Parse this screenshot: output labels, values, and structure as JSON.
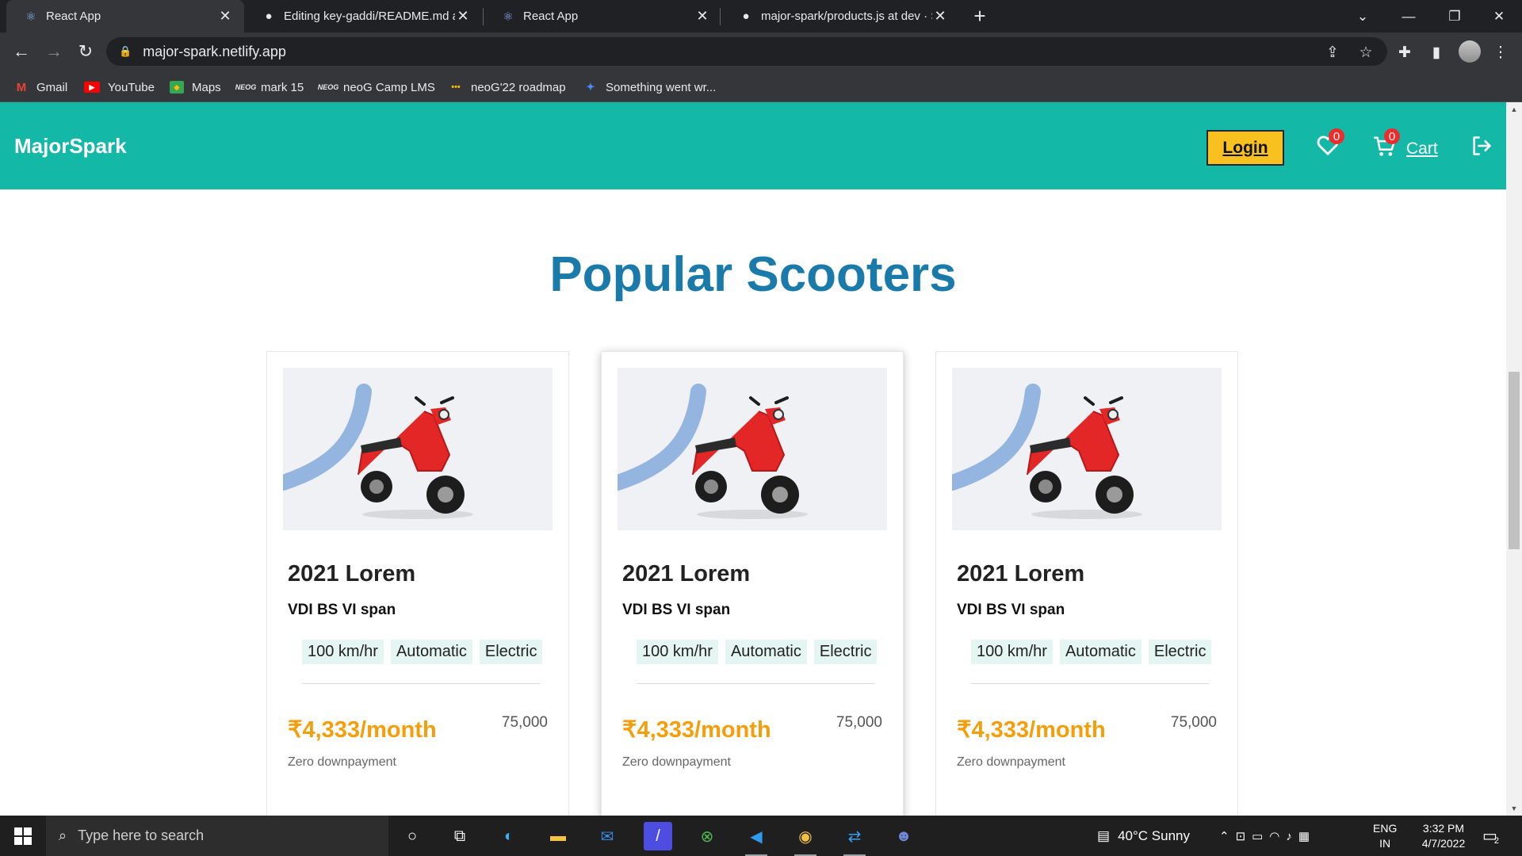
{
  "browser": {
    "tabs": [
      {
        "title": "React App",
        "icon": "react-icon",
        "active": true
      },
      {
        "title": "Editing key-gaddi/README.md a",
        "icon": "github-icon",
        "active": false
      },
      {
        "title": "React App",
        "icon": "react-icon",
        "active": false
      },
      {
        "title": "major-spark/products.js at dev · S",
        "icon": "github-icon",
        "active": false
      }
    ],
    "url": "major-spark.netlify.app",
    "bookmarks": [
      {
        "label": "Gmail",
        "icon": "gmail-icon"
      },
      {
        "label": "YouTube",
        "icon": "youtube-icon"
      },
      {
        "label": "Maps",
        "icon": "maps-icon"
      },
      {
        "label": "mark 15",
        "icon": "neog-icon"
      },
      {
        "label": "neoG Camp LMS",
        "icon": "neog-icon"
      },
      {
        "label": "neoG'22 roadmap",
        "icon": "dots-icon"
      },
      {
        "label": "Something went wr...",
        "icon": "jira-icon"
      }
    ]
  },
  "navbar": {
    "brand": "MajorSpark",
    "login_label": "Login",
    "wishlist_count": "0",
    "cart_count": "0",
    "cart_label": "Cart",
    "colors": {
      "bar": "#14b8a6",
      "login": "#f8c11f",
      "badge": "#ef2b2b"
    }
  },
  "section": {
    "title": "Popular Scooters",
    "title_color": "#1a7aaa"
  },
  "products": [
    {
      "title": "2021 Lorem",
      "subtitle": "VDI BS VI span",
      "specs": [
        "100 km/hr",
        "Automatic",
        "Electric"
      ],
      "price": "₹4,333/month",
      "mrp": "75,000",
      "note": "Zero downpayment",
      "image": "red electric scooter"
    },
    {
      "title": "2021 Lorem",
      "subtitle": "VDI BS VI span",
      "specs": [
        "100 km/hr",
        "Automatic",
        "Electric"
      ],
      "price": "₹4,333/month",
      "mrp": "75,000",
      "note": "Zero downpayment",
      "image": "red electric scooter"
    },
    {
      "title": "2021 Lorem",
      "subtitle": "VDI BS VI span",
      "specs": [
        "100 km/hr",
        "Automatic",
        "Electric"
      ],
      "price": "₹4,333/month",
      "mrp": "75,000",
      "note": "Zero downpayment",
      "image": "red electric scooter"
    }
  ],
  "taskbar": {
    "search_placeholder": "Type here to search",
    "weather": "40°C  Sunny",
    "lang_top": "ENG",
    "lang_bottom": "IN",
    "time": "3:32 PM",
    "date": "4/7/2022",
    "notifications": "2"
  }
}
